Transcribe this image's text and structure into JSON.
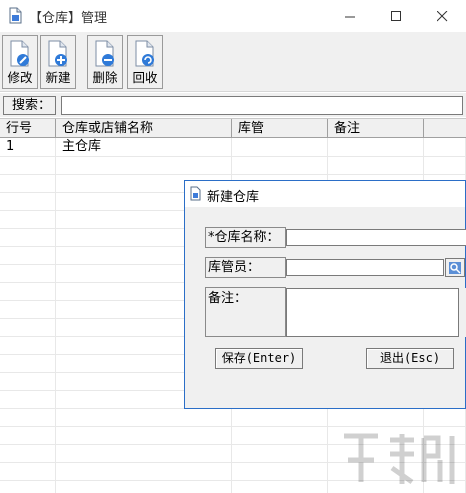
{
  "window": {
    "title": "【仓库】管理"
  },
  "toolbar": {
    "edit_label": "修改",
    "new_label": "新建",
    "delete_label": "删除",
    "recycle_label": "回收"
  },
  "search": {
    "label": "搜索：",
    "value": ""
  },
  "grid": {
    "columns": [
      "行号",
      "仓库或店铺名称",
      "库管",
      "备注"
    ],
    "rows": [
      {
        "no": "1",
        "name": "主仓库",
        "manager": "",
        "remarks": ""
      }
    ]
  },
  "dialog": {
    "title": "新建仓库",
    "name_label": "*仓库名称：",
    "manager_label": "库管员：",
    "remarks_label": "备注：",
    "name_value": "",
    "manager_value": "",
    "remarks_value": "",
    "save_label": "保存(Enter)",
    "exit_label": "退出(Esc)"
  },
  "colors": {
    "dialog_border": "#2b6ec7",
    "toolbar_bg": "#f0f0f0"
  }
}
